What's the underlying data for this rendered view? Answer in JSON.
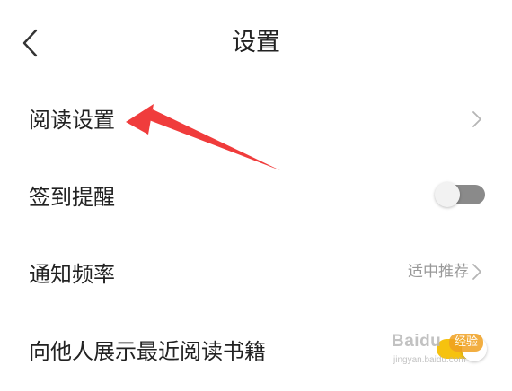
{
  "header": {
    "back_icon": "chevron-left-icon",
    "title": "设置"
  },
  "settings": {
    "reading": {
      "label": "阅读设置",
      "icon": "chevron-right-icon"
    },
    "checkin_reminder": {
      "label": "签到提醒",
      "toggle": "off"
    },
    "notification_frequency": {
      "label": "通知频率",
      "value": "适中推荐",
      "icon": "chevron-right-icon"
    },
    "show_recent_books": {
      "label": "向他人展示最近阅读书籍",
      "toggle": "on"
    }
  },
  "annotation": {
    "arrow_color": "#f03c3c",
    "arrow_icon": "red-arrow-pointer"
  },
  "watermark": {
    "brand": "Baidu",
    "badge": "经验",
    "sub": "jingyan.baidu.com"
  },
  "colors": {
    "toggle_on": "#f6c20f",
    "toggle_off": "#8a8a8a",
    "secondary_text": "#999999"
  }
}
